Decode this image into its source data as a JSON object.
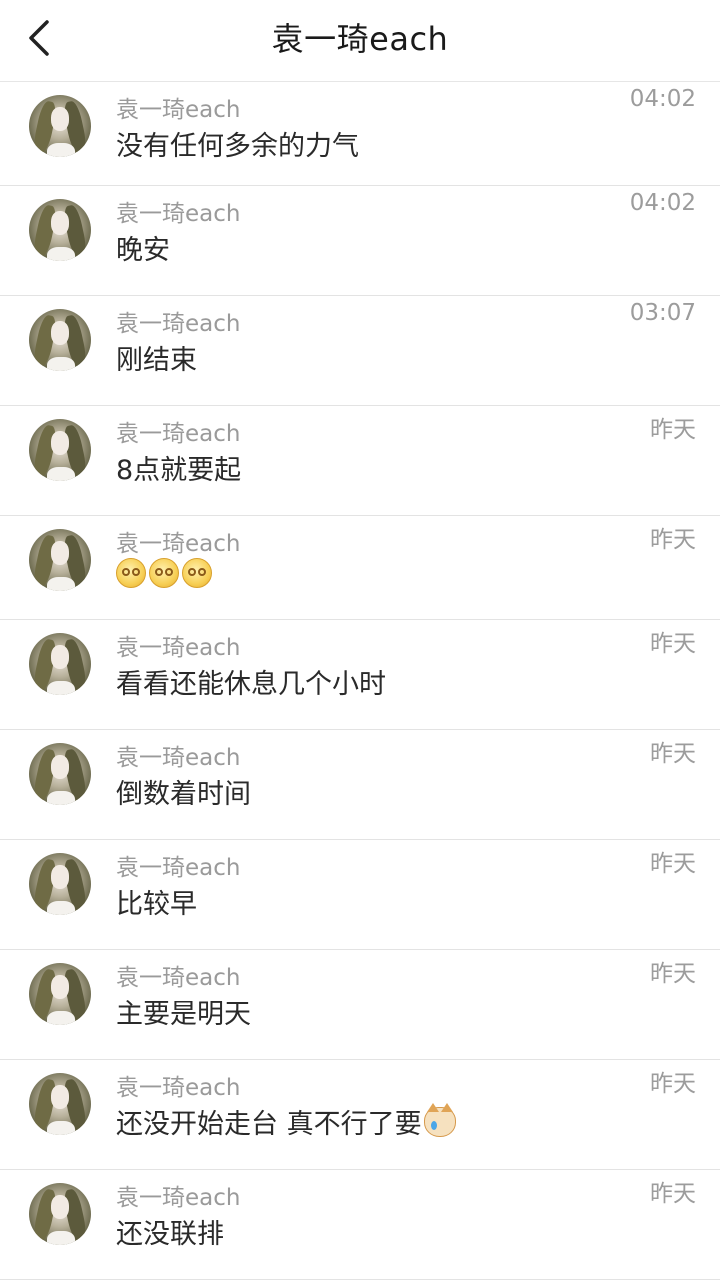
{
  "header": {
    "title": "袁一琦each"
  },
  "messages": [
    {
      "name": "袁一琦each",
      "time": "04:02",
      "text": "没有任何多余的力气"
    },
    {
      "name": "袁一琦each",
      "time": "04:02",
      "text": "晚安"
    },
    {
      "name": "袁一琦each",
      "time": "03:07",
      "text": "刚结束"
    },
    {
      "name": "袁一琦each",
      "time": "昨天",
      "text": "8点就要起"
    },
    {
      "name": "袁一琦each",
      "time": "昨天",
      "text": "",
      "emoji": "pleading-face-icon x3"
    },
    {
      "name": "袁一琦each",
      "time": "昨天",
      "text": "看看还能休息几个小时"
    },
    {
      "name": "袁一琦each",
      "time": "昨天",
      "text": "倒数着时间"
    },
    {
      "name": "袁一琦each",
      "time": "昨天",
      "text": "比较早"
    },
    {
      "name": "袁一琦each",
      "time": "昨天",
      "text": "主要是明天"
    },
    {
      "name": "袁一琦each",
      "time": "昨天",
      "text": "还没开始走台 真不行了要",
      "emoji": "crying-cat-icon"
    },
    {
      "name": "袁一琦each",
      "time": "昨天",
      "text": "还没联排"
    }
  ]
}
